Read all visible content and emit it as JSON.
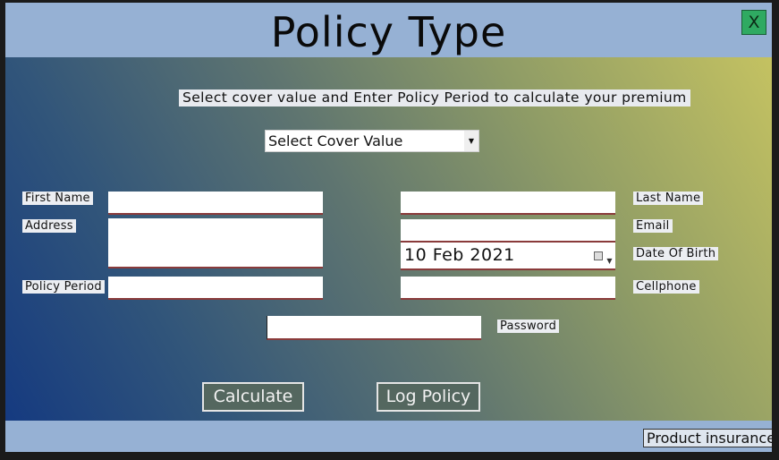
{
  "window": {
    "title": "Policy Type",
    "close_label": "X"
  },
  "instruction": "Select cover value and Enter Policy Period to calculate  your premium",
  "cover_select": {
    "selected": "Select Cover Value"
  },
  "fields": {
    "first_name_label": "First Name",
    "address_label": "Address",
    "policy_period_label": "Policy Period",
    "last_name_label": "Last Name",
    "email_label": "Email",
    "dob_label": "Date Of Birth",
    "dob_value": "10  Feb  2021",
    "cellphone_label": "Cellphone",
    "password_label": "Password"
  },
  "buttons": {
    "calculate": "Calculate",
    "log_policy": "Log Policy"
  },
  "footer": {
    "product_label": "Product insurance"
  },
  "colors": {
    "close_button": "#2faa62",
    "button_bg": "#54675f",
    "title_bar": "#96b1d4"
  }
}
